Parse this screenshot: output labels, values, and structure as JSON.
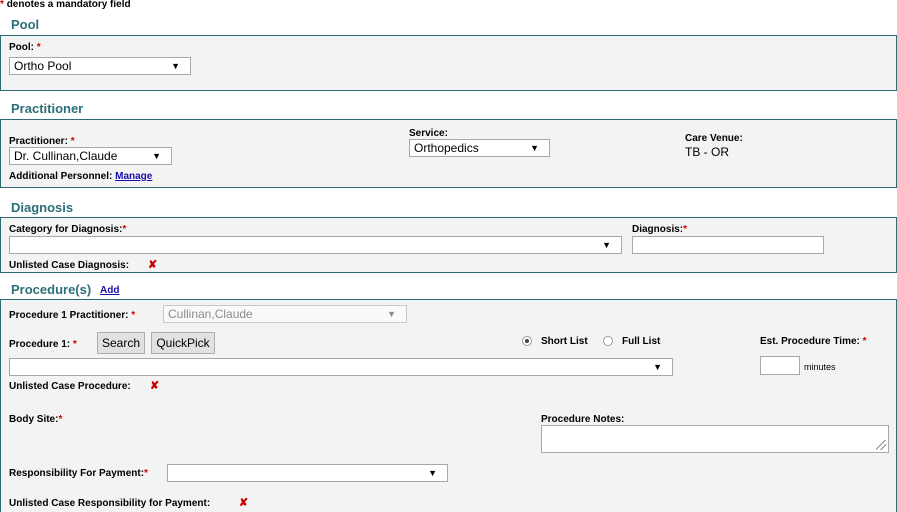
{
  "mandatory_note": {
    "star": "*",
    "text": "denotes a mandatory field"
  },
  "required_mark": "*",
  "colors": {
    "section_title": "#2c6f78",
    "panel_border": "#2e6b74",
    "panel_bg": "#f3f3f3",
    "required": "#d00000",
    "link": "#1a0dab"
  },
  "pool": {
    "title": "Pool",
    "label": "Pool:",
    "value": "Ortho Pool"
  },
  "practitioner": {
    "title": "Practitioner",
    "label": "Practitioner:",
    "value": "Dr. Cullinan,Claude",
    "service_label": "Service:",
    "service_value": "Orthopedics",
    "care_venue_label": "Care Venue:",
    "care_venue_value": "TB - OR",
    "additional_personnel_label": "Additional Personnel:",
    "manage_link": "Manage"
  },
  "diagnosis": {
    "title": "Diagnosis",
    "category_label": "Category for Diagnosis:",
    "category_value": "",
    "diagnosis_label": "Diagnosis:",
    "diagnosis_value": "",
    "unlisted_label": "Unlisted Case Diagnosis:",
    "unlisted_icon": "x-icon"
  },
  "procedures": {
    "title": "Procedure(s)",
    "add_link": "Add",
    "practitioner_label": "Procedure 1 Practitioner:",
    "practitioner_value": "Cullinan,Claude",
    "procedure_label": "Procedure 1:",
    "search_button": "Search",
    "quickpick_button": "QuickPick",
    "short_list": "Short List",
    "full_list": "Full List",
    "selected_list": "Short List",
    "procedure_value": "",
    "est_time_label": "Est. Procedure Time:",
    "est_time_value": "",
    "minutes_label": "minutes",
    "unlisted_procedure_label": "Unlisted Case Procedure:",
    "body_site_label": "Body Site:",
    "notes_label": "Procedure Notes:",
    "notes_value": "",
    "responsibility_label": "Responsibility For Payment:",
    "responsibility_value": "",
    "unlisted_responsibility_label": "Unlisted Case Responsibility for Payment:"
  }
}
